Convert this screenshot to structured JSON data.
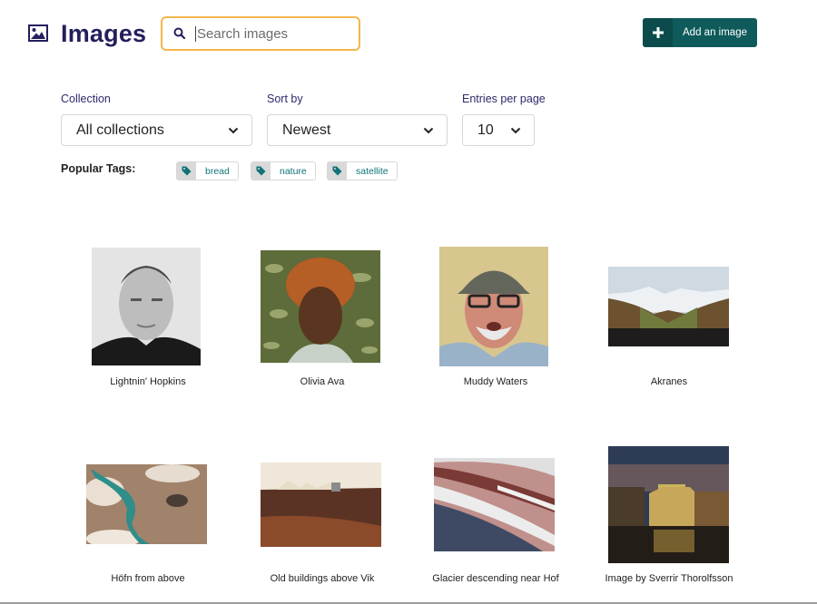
{
  "header": {
    "title": "Images",
    "icon": "image-icon",
    "search": {
      "placeholder": "Search images",
      "value": "",
      "icon": "search-icon"
    },
    "add_button": {
      "label": "Add an image",
      "icon": "plus-icon"
    }
  },
  "filters": {
    "collection": {
      "label": "Collection",
      "selected": "All collections"
    },
    "sort_by": {
      "label": "Sort by",
      "selected": "Newest"
    },
    "entries_per_page": {
      "label": "Entries per page",
      "selected": "10"
    }
  },
  "popular_tags": {
    "label": "Popular Tags:",
    "tags": [
      {
        "label": "bread",
        "icon": "tag-icon"
      },
      {
        "label": "nature",
        "icon": "tag-icon"
      },
      {
        "label": "satellite",
        "icon": "tag-icon"
      }
    ]
  },
  "images": [
    {
      "caption": "Lightnin' Hopkins"
    },
    {
      "caption": "Olivia Ava"
    },
    {
      "caption": "Muddy Waters"
    },
    {
      "caption": "Akranes"
    },
    {
      "caption": "Höfn from above"
    },
    {
      "caption": "Old buildings above Vik"
    },
    {
      "caption": "Glacier descending near Hof"
    },
    {
      "caption": "Image by Sverrir Thorolfsson"
    }
  ],
  "colors": {
    "title": "#231f5c",
    "search_focus": "#f3b74c",
    "primary_button": "#0f5a5b",
    "tag_text": "#0f7478"
  }
}
